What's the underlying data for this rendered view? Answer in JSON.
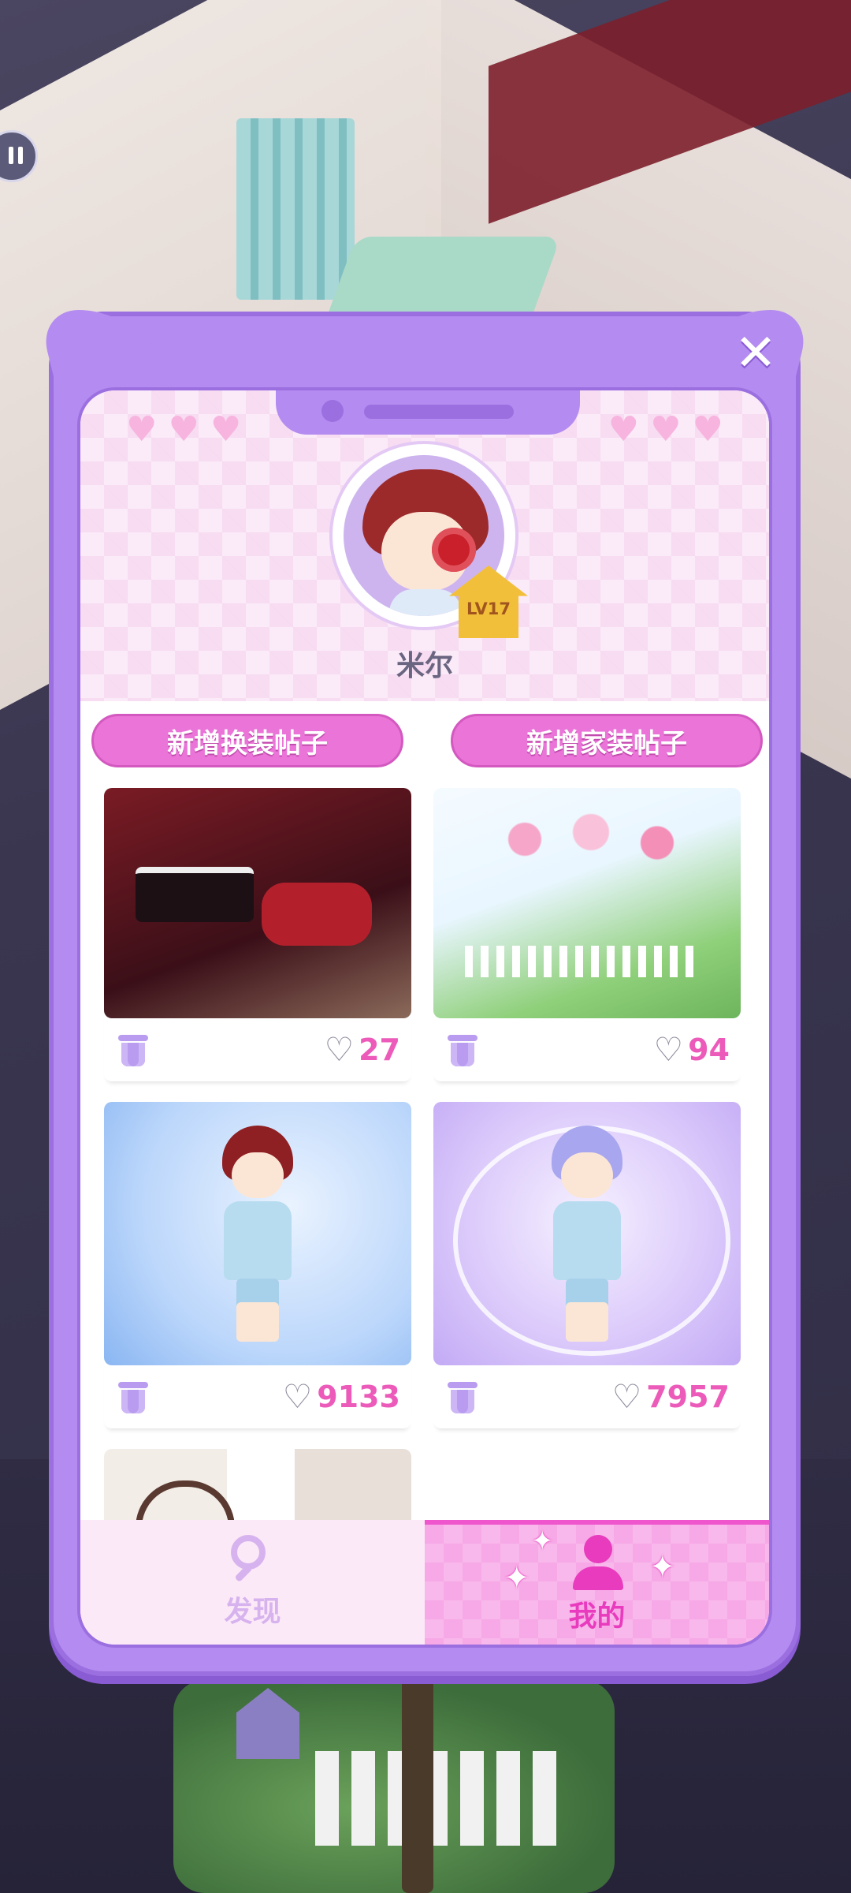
{
  "profile": {
    "username": "米尔",
    "level_badge": "LV17"
  },
  "actions": {
    "new_outfit_post": "新增换装帖子",
    "new_home_post": "新增家装帖子"
  },
  "posts": [
    {
      "kind": "home",
      "likes": "27"
    },
    {
      "kind": "home",
      "likes": "94"
    },
    {
      "kind": "outfit",
      "likes": "9133"
    },
    {
      "kind": "outfit",
      "likes": "7957"
    },
    {
      "kind": "home",
      "likes": ""
    }
  ],
  "tabs": {
    "discover": "发现",
    "mine": "我的",
    "active": "mine"
  },
  "icons": {
    "close": "close-icon",
    "heart": "heart-outline-icon",
    "trash": "trash-icon",
    "search": "search-icon",
    "person": "person-icon"
  },
  "colors": {
    "dialog_frame": "#b48bf0",
    "action_pill": "#ea74d8",
    "like_count": "#ec5bb9",
    "active_tab": "#f7a8e6",
    "level_badge": "#f2bf3a"
  }
}
